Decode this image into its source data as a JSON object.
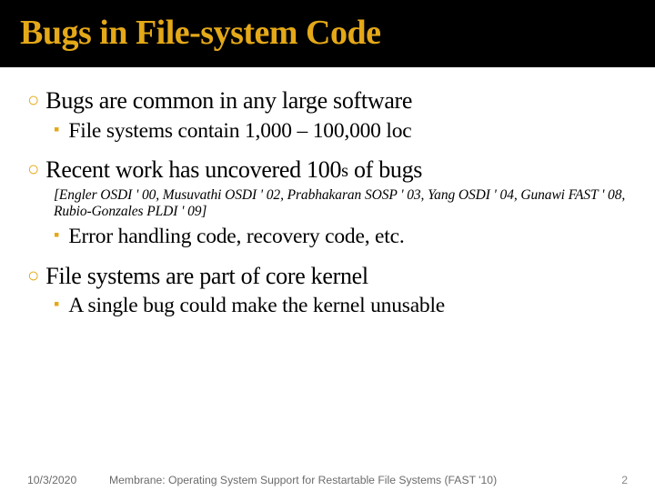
{
  "title": "Bugs in File-system Code",
  "bullets": [
    {
      "text": "Bugs are common in any large software",
      "sub": [
        {
          "text": "File systems contain 1,000 – 100,000 loc"
        }
      ]
    },
    {
      "text_html": "Recent work has uncovered 100<span class='smallcaps'>s</span> of bugs",
      "citation": "[Engler OSDI ' 00, Musuvathi OSDI ' 02, Prabhakaran SOSP ' 03, Yang OSDI ' 04, Gunawi FAST ' 08, Rubio-Gonzales PLDI ' 09]",
      "sub": [
        {
          "text": "Error handling code, recovery code, etc."
        }
      ]
    },
    {
      "text": "File systems are part of core kernel",
      "sub": [
        {
          "text": "A single bug could make the kernel unusable"
        }
      ]
    }
  ],
  "footer": {
    "date": "10/3/2020",
    "title": "Membrane: Operating System Support for Restartable File Systems (FAST '10)",
    "page": "2"
  }
}
